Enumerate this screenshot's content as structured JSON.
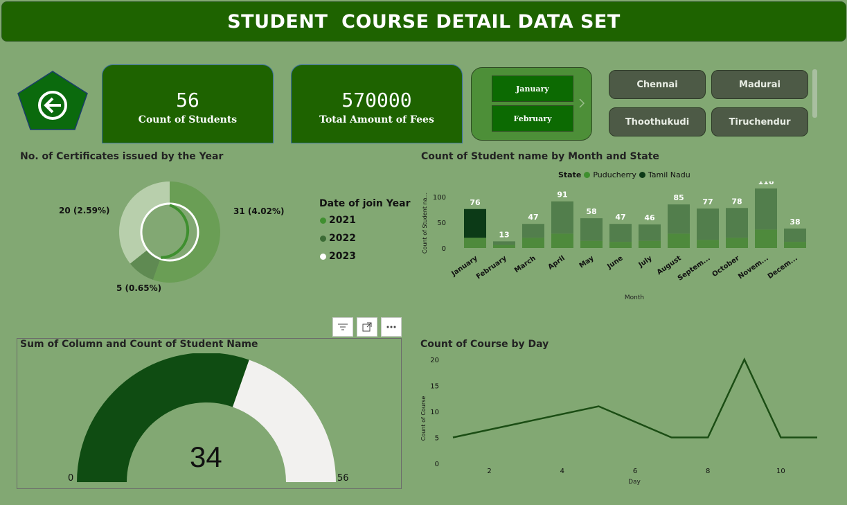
{
  "header": {
    "title": "STUDENT  COURSE DETAIL DATA SET"
  },
  "kpis": [
    {
      "value": "56",
      "label": "Count of Students"
    },
    {
      "value": "570000",
      "label": "Total Amount of Fees"
    }
  ],
  "month_slicer": {
    "items": [
      "January",
      "February"
    ]
  },
  "city_slicer": {
    "items": [
      "Chennai",
      "Madurai",
      "Thoothukudi",
      "Tiruchendur"
    ]
  },
  "icons": {
    "back": "arrow-left-circle-icon",
    "filter": "filter-icon",
    "focus": "focus-mode-icon",
    "more": "more-options-icon",
    "next": "chevron-right-icon"
  },
  "colors": {
    "title_bg": "#1e6300",
    "page_bg": "#82a873",
    "accent_2021": "#3f8f2f",
    "accent_2022": "#3b6b35",
    "accent_2023": "#ffffff"
  },
  "donut": {
    "title": "No. of Certificates issued by the Year",
    "legend_title": "Date of join Year",
    "legend": [
      {
        "label": "2021",
        "color": "#3f8f2f"
      },
      {
        "label": "2022",
        "color": "#3b6b35"
      },
      {
        "label": "2023",
        "color": "#ffffff"
      }
    ],
    "labels": [
      "31 (4.02%)",
      "5 (0.65%)",
      "20 (2.59%)"
    ]
  },
  "bar_chart": {
    "title": "Count of Student name by Month and State",
    "legend_title": "State",
    "xlabel": "Month",
    "ylabel": "Count of Student na...",
    "y_ticks": [
      "0",
      "50",
      "100"
    ],
    "x_labels": [
      "January",
      "February",
      "March",
      "April",
      "May",
      "June",
      "July",
      "August",
      "Septem...",
      "October",
      "Novem...",
      "Decem..."
    ]
  },
  "gauge": {
    "title": "Sum of Column and Count of Student Name",
    "value_label": "34",
    "min_label": "0",
    "max_label": "56"
  },
  "line_chart": {
    "title": "Count of Course by Day",
    "xlabel": "Day",
    "ylabel": "Count of Course",
    "x_ticks": [
      "2",
      "4",
      "6",
      "8",
      "10"
    ],
    "y_ticks": [
      "0",
      "5",
      "10",
      "15",
      "20"
    ]
  },
  "chart_data": [
    {
      "type": "pie",
      "title": "No. of Certificates issued by the Year",
      "categories": [
        "2021",
        "2022",
        "2023"
      ],
      "values": [
        31,
        5,
        20
      ],
      "percent": [
        4.02,
        0.65,
        2.59
      ],
      "colors": [
        "#6a9e55",
        "#5f8a52",
        "#b8cfac"
      ]
    },
    {
      "type": "bar",
      "title": "Count of Student name by Month and State",
      "categories": [
        "January",
        "February",
        "March",
        "April",
        "May",
        "June",
        "July",
        "August",
        "September",
        "October",
        "November",
        "December"
      ],
      "series": [
        {
          "name": "Puducherry",
          "values": [
            20,
            6,
            20,
            28,
            14,
            12,
            14,
            28,
            16,
            20,
            36,
            12
          ],
          "color": "#4e8a3c"
        },
        {
          "name": "Tamil Nadu",
          "values": [
            56,
            7,
            27,
            63,
            44,
            35,
            32,
            57,
            61,
            58,
            80,
            26
          ],
          "color": "#527e4c"
        }
      ],
      "totals": [
        76,
        13,
        47,
        91,
        58,
        47,
        46,
        85,
        77,
        78,
        116,
        38
      ],
      "ylim": [
        0,
        120
      ],
      "xlabel": "Month",
      "ylabel": "Count of Student na...",
      "highlight_color": "#0c3a17"
    },
    {
      "type": "line",
      "title": "Count of Course by Day",
      "x": [
        1,
        3,
        5,
        7,
        8,
        9,
        10,
        11
      ],
      "y": [
        5,
        8,
        11,
        5,
        5,
        20,
        5,
        5
      ],
      "xlim": [
        1,
        11
      ],
      "ylim": [
        0,
        20
      ],
      "xlabel": "Day",
      "ylabel": "Count of Course",
      "color": "#1b4d14"
    },
    {
      "type": "gauge",
      "title": "Sum of Column and Count of Student Name",
      "value": 34,
      "min": 0,
      "max": 56,
      "colors": [
        "#0f4c12",
        "#f2f1ef"
      ]
    }
  ]
}
